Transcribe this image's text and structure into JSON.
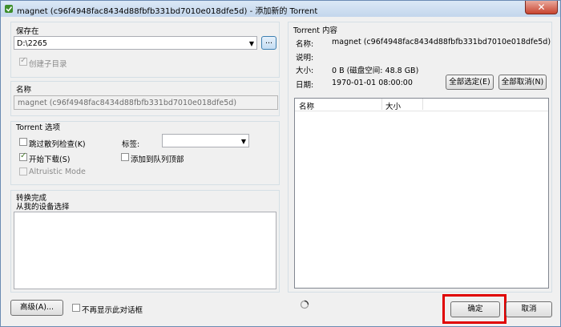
{
  "window": {
    "title": "magnet (c96f4948fac8434d88fbfb331bd7010e018dfe5d) - 添加新的 Torrent",
    "close_label": "✕"
  },
  "save": {
    "group_label": "保存在",
    "path": "D:\\2265",
    "browse_label": "...",
    "create_subfolder_label": "创建子目录",
    "create_subfolder_checked": true
  },
  "name": {
    "group_label": "名称",
    "value": "magnet (c96f4948fac8434d88fbfb331bd7010e018dfe5d)"
  },
  "options": {
    "group_label": "Torrent 选项",
    "skip_hash_label": "跳过散列检查(K)",
    "start_label": "开始下载(S)",
    "altruistic_label": "Altruistic Mode",
    "tag_label": "标签:",
    "tag_value": "",
    "queue_top_label": "添加到队列顶部"
  },
  "convert": {
    "group_label": "转换完成",
    "sub_label": "从我的设备选择"
  },
  "torrent_content": {
    "group_label": "Torrent 内容",
    "name_label": "名称:",
    "name_value": "magnet (c96f4948fac8434d88fbfb331bd7010e018dfe5d)",
    "desc_label": "说明:",
    "size_label": "大小:",
    "size_value": "0 B (磁盘空间: 48.8 GB)",
    "date_label": "日期:",
    "date_value": "1970-01-01 08:00:00",
    "select_all_label": "全部选定(E)",
    "deselect_all_label": "全部取消(N)",
    "columns": [
      "名称",
      "大小"
    ]
  },
  "footer": {
    "advanced_label": "高级(A)...",
    "dont_show_label": "不再显示此对话框",
    "ok_label": "确定",
    "cancel_label": "取消"
  },
  "colors": {
    "highlight": "#e00000"
  }
}
